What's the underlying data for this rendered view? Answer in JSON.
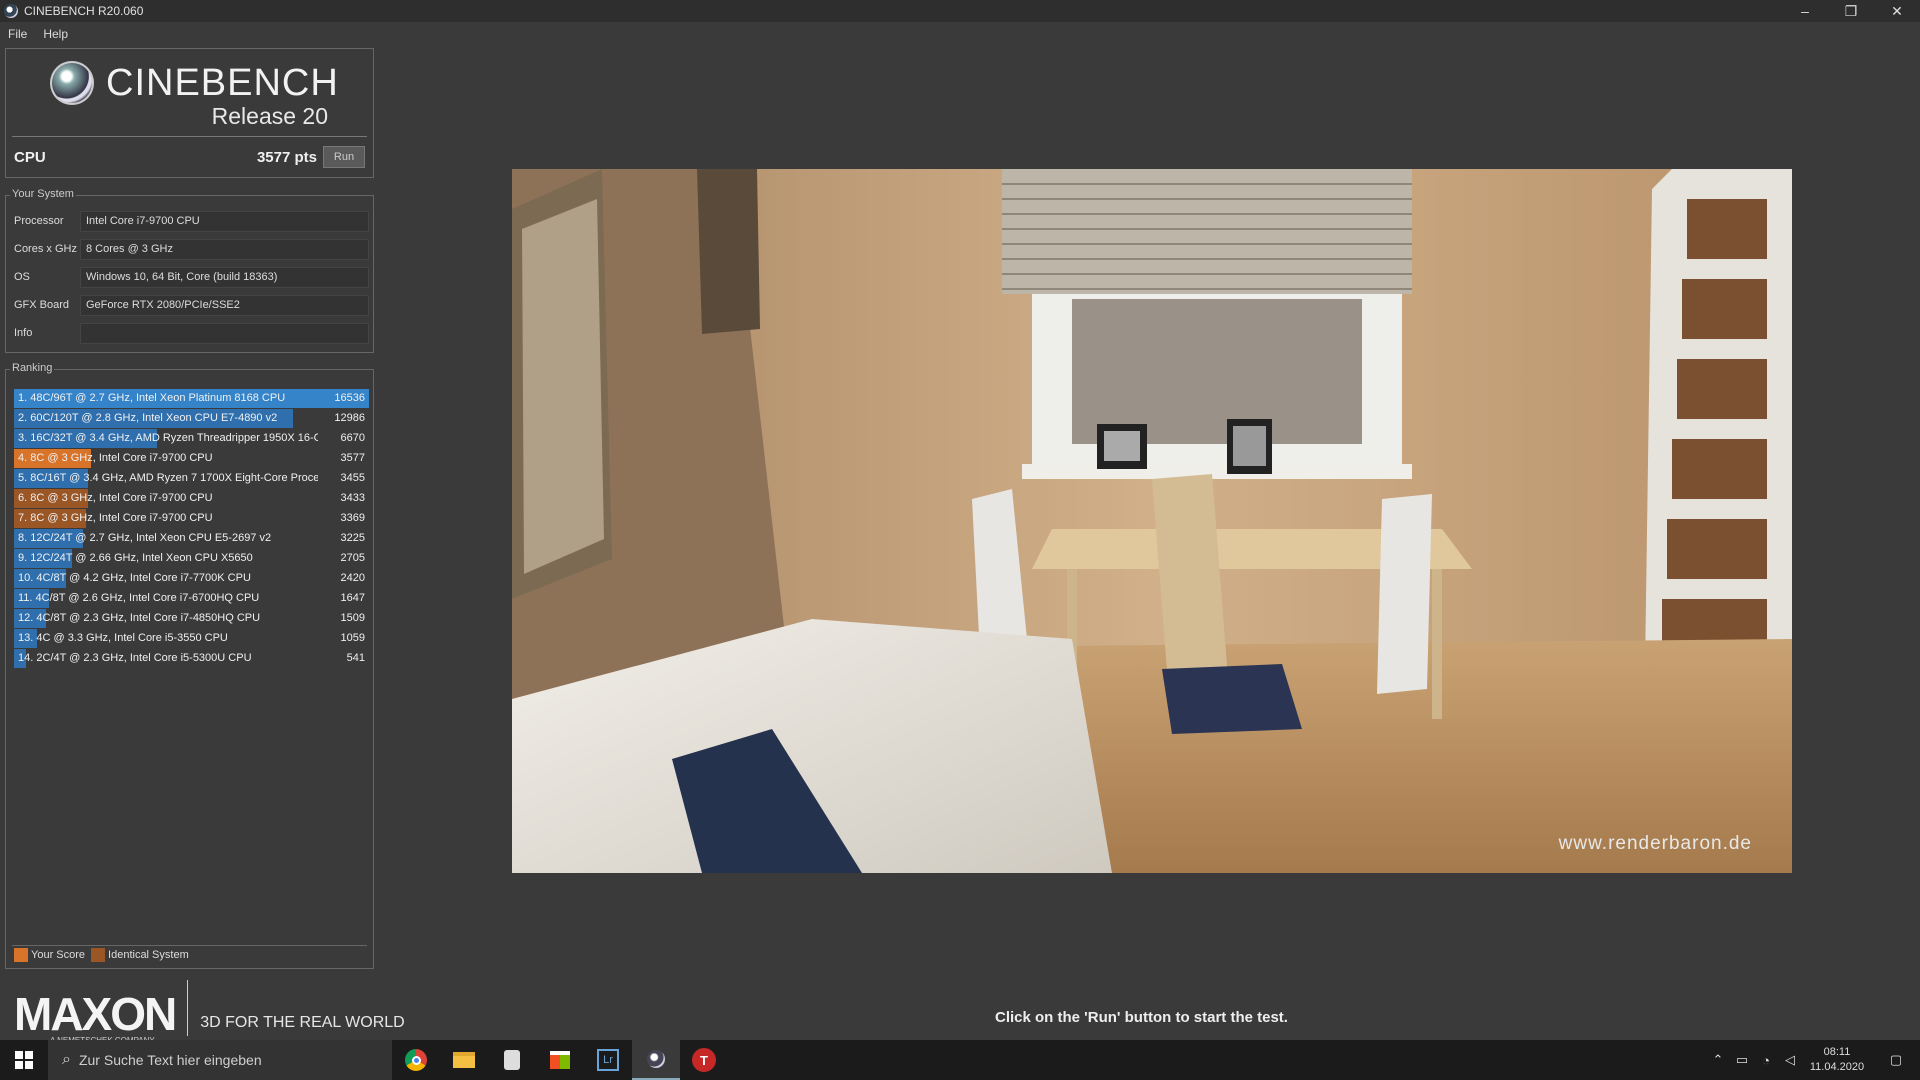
{
  "window": {
    "title": "CINEBENCH R20.060",
    "minimize": "–",
    "restore": "❐",
    "close": "✕"
  },
  "menu": [
    "File",
    "Help"
  ],
  "header": {
    "product": "CINEBENCH",
    "release": "Release 20",
    "cpu_label": "CPU",
    "cpu_score": "3577 pts",
    "run_label": "Run"
  },
  "system": {
    "title": "Your System",
    "rows": [
      {
        "label": "Processor",
        "value": "Intel Core i7-9700 CPU"
      },
      {
        "label": "Cores x GHz",
        "value": "8 Cores @ 3 GHz"
      },
      {
        "label": "OS",
        "value": "Windows 10, 64 Bit, Core (build 18363)"
      },
      {
        "label": "GFX Board",
        "value": "GeForce RTX 2080/PCIe/SSE2"
      },
      {
        "label": "Info",
        "value": ""
      }
    ]
  },
  "ranking": {
    "title": "Ranking",
    "max_score": 16536,
    "rows": [
      {
        "text": "1. 48C/96T @ 2.7 GHz, Intel Xeon Platinum 8168 CPU",
        "score": "16536",
        "value": 16536,
        "kind": "other"
      },
      {
        "text": "2. 60C/120T @ 2.8 GHz, Intel Xeon CPU E7-4890 v2",
        "score": "12986",
        "value": 12986,
        "kind": "other"
      },
      {
        "text": "3. 16C/32T @ 3.4 GHz, AMD Ryzen Threadripper 1950X 16-C",
        "score": "6670",
        "value": 6670,
        "kind": "other"
      },
      {
        "text": "4. 8C @ 3 GHz, Intel Core i7-9700 CPU",
        "score": "3577",
        "value": 3577,
        "kind": "yours"
      },
      {
        "text": "5. 8C/16T @ 3.4 GHz, AMD Ryzen 7 1700X Eight-Core Proce:",
        "score": "3455",
        "value": 3455,
        "kind": "other"
      },
      {
        "text": "6. 8C @ 3 GHz, Intel Core i7-9700 CPU",
        "score": "3433",
        "value": 3433,
        "kind": "identical"
      },
      {
        "text": "7. 8C @ 3 GHz, Intel Core i7-9700 CPU",
        "score": "3369",
        "value": 3369,
        "kind": "identical"
      },
      {
        "text": "8. 12C/24T @ 2.7 GHz, Intel Xeon CPU E5-2697 v2",
        "score": "3225",
        "value": 3225,
        "kind": "other"
      },
      {
        "text": "9. 12C/24T @ 2.66 GHz, Intel Xeon CPU X5650",
        "score": "2705",
        "value": 2705,
        "kind": "other"
      },
      {
        "text": "10. 4C/8T @ 4.2 GHz, Intel Core i7-7700K CPU",
        "score": "2420",
        "value": 2420,
        "kind": "other"
      },
      {
        "text": "11. 4C/8T @ 2.6 GHz, Intel Core i7-6700HQ CPU",
        "score": "1647",
        "value": 1647,
        "kind": "other"
      },
      {
        "text": "12. 4C/8T @ 2.3 GHz, Intel Core i7-4850HQ CPU",
        "score": "1509",
        "value": 1509,
        "kind": "other"
      },
      {
        "text": "13. 4C @ 3.3 GHz, Intel Core i5-3550 CPU",
        "score": "1059",
        "value": 1059,
        "kind": "other"
      },
      {
        "text": "14. 2C/4T @ 2.3 GHz, Intel Core i5-5300U CPU",
        "score": "541",
        "value": 541,
        "kind": "other"
      }
    ],
    "legend": {
      "your_score": "Your Score",
      "identical": "Identical System"
    }
  },
  "colors": {
    "other": "#2f6fae",
    "yours": "#d8732a",
    "identical": "#9b5626",
    "first": "#3583c9"
  },
  "footer": {
    "brand": "MAXON",
    "sub": "A NEMETSCHEK COMPANY",
    "tagline": "3D FOR THE REAL WORLD"
  },
  "render": {
    "watermark": "www.renderbaron.de"
  },
  "hint": "Click on the 'Run' button to start the test.",
  "taskbar": {
    "search_placeholder": "Zur Suche Text hier eingeben",
    "apps": [
      "chrome-icon",
      "file-explorer-icon",
      "media-icon",
      "store-icon",
      "lightroom-icon",
      "cinebench-icon",
      "t-app-icon"
    ],
    "time": "08:11",
    "date": "11.04.2020"
  }
}
